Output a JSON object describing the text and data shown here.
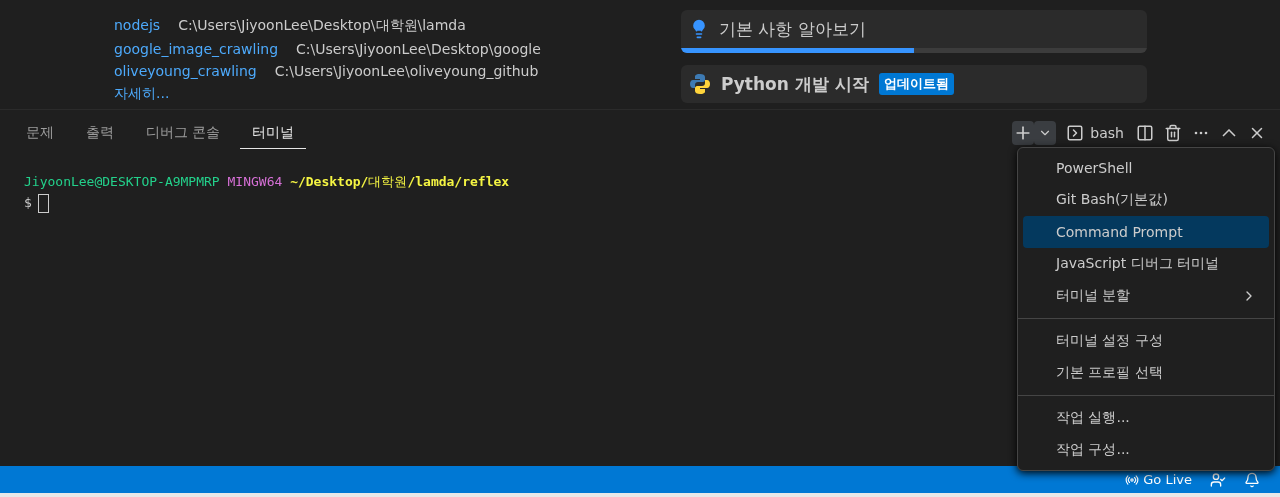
{
  "recent": [
    {
      "name": "nodejs",
      "path": "C:\\Users\\JiyoonLee\\Desktop\\대학원\\lamda"
    },
    {
      "name": "google_image_crawling",
      "path": "C:\\Users\\JiyoonLee\\Desktop\\google"
    },
    {
      "name": "oliveyoung_crawling",
      "path": "C:\\Users\\JiyoonLee\\oliveyoung_github"
    }
  ],
  "more_link": "자세히...",
  "walkthroughs": [
    {
      "kind": "bulb",
      "title": "기본 사항 알아보기",
      "level": 0.5
    },
    {
      "kind": "python",
      "title": "Python 개발 시작",
      "badge": "업데이트됨"
    }
  ],
  "panel_tabs": [
    {
      "label": "문제",
      "selected": false
    },
    {
      "label": "출력",
      "selected": false
    },
    {
      "label": "디버그 콘솔",
      "selected": false
    },
    {
      "label": "터미널",
      "selected": true
    }
  ],
  "terminal_toolbar": {
    "profile": "bash"
  },
  "terminal": {
    "user": "JiyoonLee@DESKTOP-A9MPMRP",
    "system": "MINGW64",
    "path_start": "~/Desktop/",
    "path_korean": "대학원",
    "path_end": "/lamda/reflex",
    "prompt": "$"
  },
  "menu": [
    [
      {
        "label": "PowerShell",
        "selected": false
      },
      {
        "label": "Git Bash(기본값)",
        "selected": false
      },
      {
        "label": "Command Prompt",
        "selected": true
      },
      {
        "label": "JavaScript 디버그 터미널",
        "selected": false
      },
      {
        "label": "터미널 분할",
        "selected": false,
        "submenu": true
      }
    ],
    [
      {
        "label": "터미널 설정 구성",
        "selected": false
      },
      {
        "label": "기본 프로필 선택",
        "selected": false
      }
    ],
    [
      {
        "label": "작업 실행...",
        "selected": false
      },
      {
        "label": "작업 구성...",
        "selected": false
      }
    ]
  ],
  "status_bar": {
    "go_live": "Go Live"
  }
}
